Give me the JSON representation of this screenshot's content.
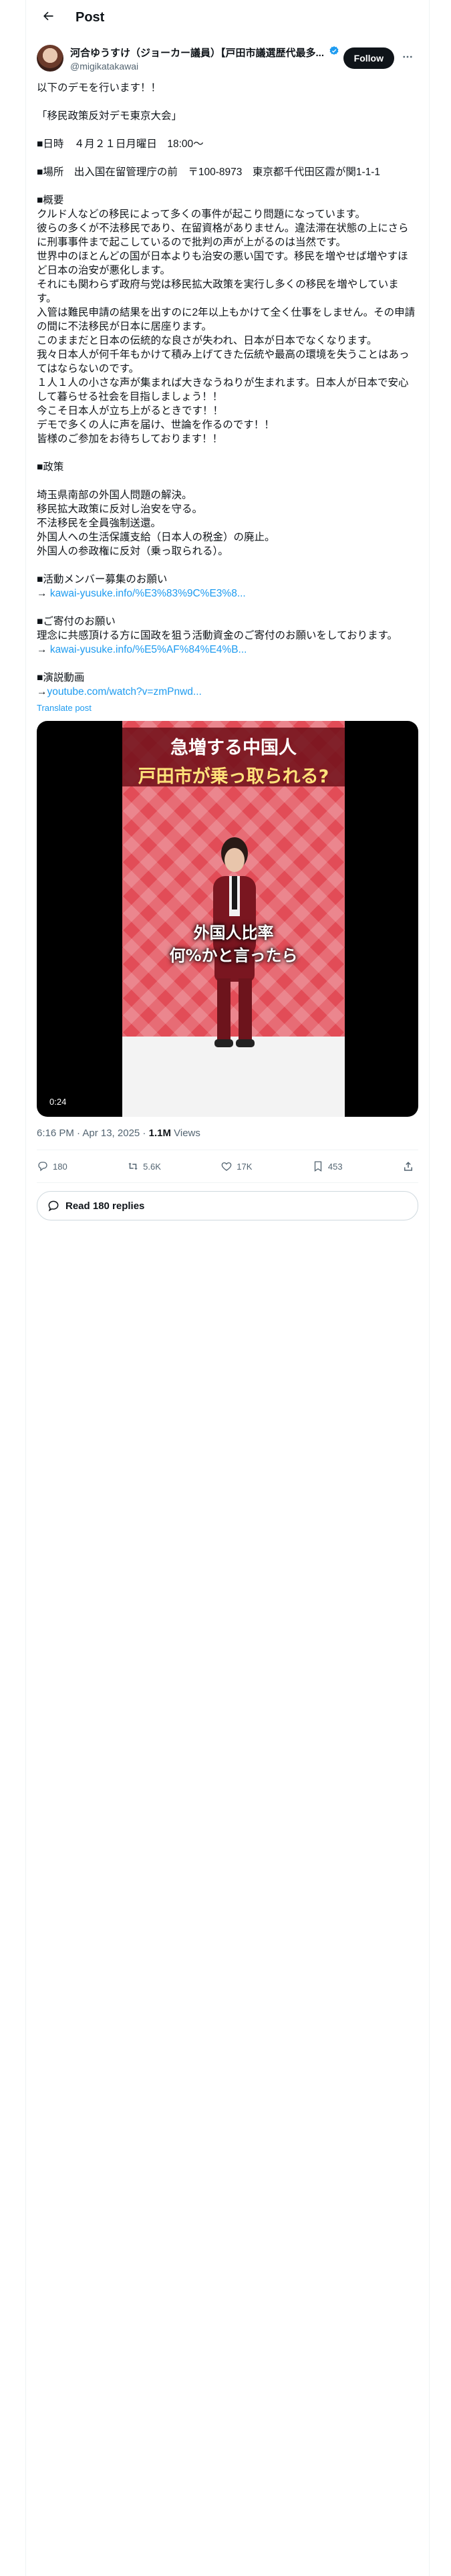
{
  "header": {
    "title": "Post"
  },
  "author": {
    "display_name": "河合ゆうすけ（ジョーカー議員）【戸田市議選歴代最多...",
    "handle": "@migikatakawai",
    "follow_label": "Follow"
  },
  "tweet": {
    "lines": [
      "以下のデモを行います！！",
      "",
      "「移民政策反対デモ東京大会」",
      "",
      "■日時　４月２１日月曜日　18:00〜",
      "",
      "■場所　出入国在留管理庁の前　〒100-8973　東京都千代田区霞が関1-1-1",
      "",
      "■概要",
      "クルド人などの移民によって多くの事件が起こり問題になっています。",
      "彼らの多くが不法移民であり、在留資格がありません。違法滞在状態の上にさらに刑事事件まで起こしているので批判の声が上がるのは当然です。",
      "世界中のほとんどの国が日本よりも治安の悪い国です。移民を増やせば増やすほど日本の治安が悪化します。",
      "それにも関わらず政府与党は移民拡大政策を実行し多くの移民を増やしています。",
      "入管は難民申請の結果を出すのに2年以上もかけて全く仕事をしません。その申請の間に不法移民が日本に居座ります。",
      "このままだと日本の伝統的な良さが失われ、日本が日本でなくなります。",
      "我々日本人が何千年もかけて積み上げてきた伝統や最高の環境を失うことはあってはならないのです。",
      "１人１人の小さな声が集まれば大きなうねりが生まれます。日本人が日本で安心して暮らせる社会を目指しましょう！！",
      "今こそ日本人が立ち上がるときです！！",
      "デモで多くの人に声を届け、世論を作るのです！！",
      "皆様のご参加をお待ちしております！！",
      "",
      "■政策",
      "",
      "埼玉県南部の外国人問題の解決。",
      "移民拡大政策に反対し治安を守る。",
      "不法移民を全員強制送還。",
      "外国人への生活保護支給（日本人の税金）の廃止。",
      "外国人の参政権に反対（乗っ取られる）。",
      "",
      "■活動メンバー募集のお願い"
    ],
    "link1_prefix": "→ ",
    "link1": "kawai-yusuke.info/%E3%83%9C%E3%8...",
    "lines2": [
      "",
      "■ご寄付のお願い",
      "理念に共感頂ける方に国政を狙う活動資金のご寄付のお願いをしております。"
    ],
    "link2_prefix": "→ ",
    "link2": "kawai-yusuke.info/%E5%AF%84%E4%B...",
    "lines3": [
      "",
      "■演説動画"
    ],
    "link3_prefix": "→",
    "link3": "youtube.com/watch?v=zmPnwd...",
    "translate_label": "Translate post"
  },
  "media": {
    "headline_line1": "急増する中国人",
    "headline_line2": "戸田市が乗っ取られる?",
    "caption_line1": "外国人比率",
    "caption_line2": "何%かと言ったら",
    "duration": "0:24",
    "colors": {
      "background": "#e24c57",
      "band": "#6e0f19"
    }
  },
  "meta": {
    "time": "6:16 PM · Apr 13, 2025",
    "separator": " · ",
    "views_count": "1.1M",
    "views_label": " Views"
  },
  "actions": {
    "replies": "180",
    "reposts": "5.6K",
    "likes": "17K",
    "bookmarks": "453"
  },
  "read_replies_label": "Read 180 replies",
  "icons": [
    "back-arrow-icon",
    "verified-badge-icon",
    "more-icon",
    "reply-icon",
    "repost-icon",
    "like-icon",
    "bookmark-icon",
    "share-icon",
    "speech-bubble-icon"
  ]
}
